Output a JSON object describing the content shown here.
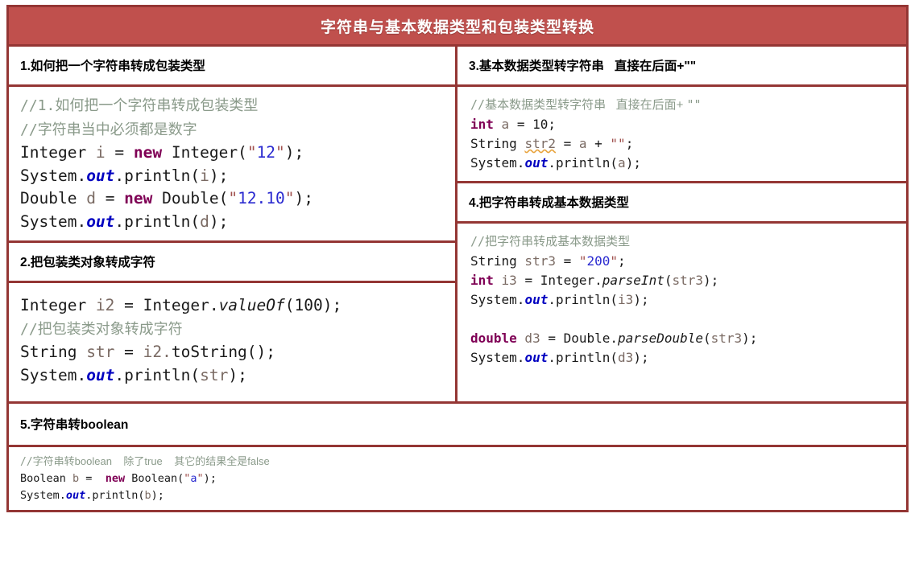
{
  "title": "字符串与基本数据类型和包装类型转换",
  "theme": {
    "header_bg": "#c0504d",
    "border": "#943634",
    "title_color": "#ffffff"
  },
  "sections": {
    "s1": {
      "heading": "1.如何把一个字符串转成包装类型"
    },
    "s2": {
      "heading": "2.把包装类对象转成字符"
    },
    "s3": {
      "heading": "3.基本数据类型转字符串   直接在后面+\"\""
    },
    "s4": {
      "heading": "4.把字符串转成基本数据类型"
    },
    "s5": {
      "heading": "5.字符串转boolean"
    }
  },
  "code": {
    "c1": {
      "comment1_slashes": "//1.",
      "comment1_text": "如何把一个字符串转成包装类型",
      "comment2_slashes": "//",
      "comment2_text": "字符串当中必须都是数字",
      "l3_type": "Integer",
      "l3_var": " i ",
      "l3_eq": "= ",
      "l3_new": "new",
      "l3_ctor": " Integer(",
      "l3_q1": "\"",
      "l3_str": "12",
      "l3_q2": "\"",
      "l3_end": ");",
      "l4_sys": "System.",
      "l4_out": "out",
      "l4_print": ".println(",
      "l4_arg": "i",
      "l4_end": ");",
      "l5_type": "Double",
      "l5_var": " d ",
      "l5_eq": "= ",
      "l5_new": "new",
      "l5_ctor": " Double(",
      "l5_q1": "\"",
      "l5_str": "12.10",
      "l5_q2": "\"",
      "l5_end": ");",
      "l6_sys": "System.",
      "l6_out": "out",
      "l6_print": ".println(",
      "l6_arg": "d",
      "l6_end": ");"
    },
    "c2": {
      "l1_type": "Integer",
      "l1_var": " i2 ",
      "l1_eq": "= ",
      "l1_cls": "Integer.",
      "l1_mth": "valueOf",
      "l1_open": "(",
      "l1_num": "100",
      "l1_end": ");",
      "comment_slashes": "//",
      "comment_text": "把包装类对象转成字符",
      "l3_type": "String",
      "l3_var": " str ",
      "l3_eq": "= ",
      "l3_recv": "i2.",
      "l3_mth": "toString",
      "l3_end": "();",
      "l4_sys": "System.",
      "l4_out": "out",
      "l4_print": ".println(",
      "l4_arg": "str",
      "l4_end": ");"
    },
    "c3": {
      "comment_slashes": "//",
      "comment_text": "基本数据类型转字符串   直接在后面+ ",
      "comment_quotes": "\"\"",
      "l2_kw": "int",
      "l2_var": " a ",
      "l2_eq": "= ",
      "l2_num": "10",
      "l2_end": ";",
      "l3_type": "String",
      "l3_var": "str2",
      "l3_eq": " = ",
      "l3_a": "a",
      "l3_plus": " + ",
      "l3_q": "\"\"",
      "l3_end": ";",
      "l4_sys": "System.",
      "l4_out": "out",
      "l4_print": ".println(",
      "l4_arg": "a",
      "l4_end": ");"
    },
    "c4": {
      "comment_slashes": "//",
      "comment_text": "把字符串转成基本数据类型",
      "l2_type": "String",
      "l2_var": " str3 ",
      "l2_eq": "= ",
      "l2_q1": "\"",
      "l2_str": "200",
      "l2_q2": "\"",
      "l2_end": ";",
      "l3_kw": "int",
      "l3_var": " i3 ",
      "l3_eq": "= ",
      "l3_cls": "Integer.",
      "l3_mth": "parseInt",
      "l3_open": "(",
      "l3_arg": "str3",
      "l3_end": ");",
      "l4_sys": "System.",
      "l4_out": "out",
      "l4_print": ".println(",
      "l4_arg": "i3",
      "l4_end": ");",
      "l6_kw": "double",
      "l6_var": " d3 ",
      "l6_eq": "= ",
      "l6_cls": "Double.",
      "l6_mth": "parseDouble",
      "l6_open": "(",
      "l6_arg": "str3",
      "l6_end": ");",
      "l7_sys": "System.",
      "l7_out": "out",
      "l7_print": ".println(",
      "l7_arg": "d3",
      "l7_end": ");"
    },
    "c5": {
      "comment_slashes": "//",
      "comment_a": "字符串转boolean",
      "comment_b": "    除了true",
      "comment_c": "    其它的结果全是false",
      "l2_type": "Boolean",
      "l2_var": " b ",
      "l2_eq": "=  ",
      "l2_new": "new",
      "l2_ctor": " Boolean(",
      "l2_q1": "\"",
      "l2_str": "a",
      "l2_q2": "\"",
      "l2_end": ");",
      "l3_sys": "System.",
      "l3_out": "out",
      "l3_print": ".println(",
      "l3_arg": "b",
      "l3_end": ");"
    }
  }
}
